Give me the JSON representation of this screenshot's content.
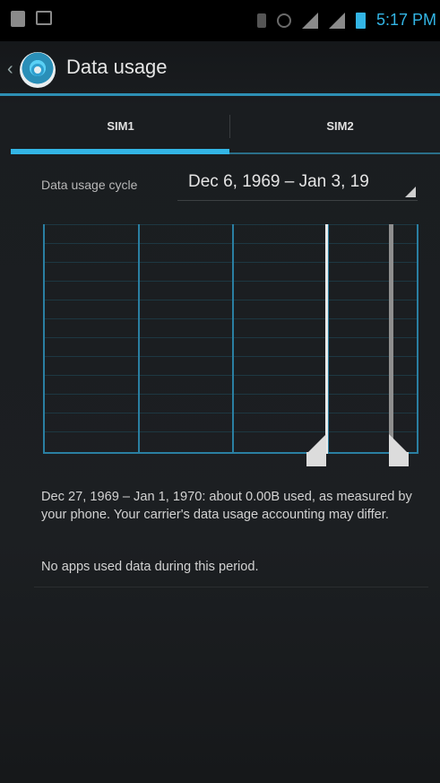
{
  "status_bar": {
    "time": "5:17 PM",
    "icons": [
      "sim-icon",
      "image-icon",
      "vibrate-icon",
      "sync-icon",
      "signal-icon",
      "signal-2-icon",
      "battery-icon"
    ],
    "accent": "#33b5e5"
  },
  "action_bar": {
    "title": "Data usage",
    "icon": "settings-gear-icon"
  },
  "tabs": [
    {
      "label": "SIM1",
      "selected": true
    },
    {
      "label": "SIM2",
      "selected": false
    }
  ],
  "cycle": {
    "label": "Data usage cycle",
    "value": "Dec 6, 1969 – Jan 3, 19"
  },
  "summary": {
    "usage_text": "Dec 27, 1969 – Jan 1, 1970: about 0.00B used, as measured by your phone. Your carrier's data usage accounting may differ.",
    "no_apps_text": "No apps used data during this period."
  },
  "colors": {
    "accent": "#33b5e5",
    "background": "#1a1d20",
    "grid": "#2a7fa2"
  }
}
